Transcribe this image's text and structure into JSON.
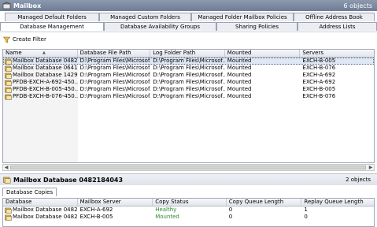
{
  "window": {
    "title": "Mailbox",
    "object_count": "6 objects"
  },
  "tabs_row1": [
    "Managed Default Folders",
    "Managed Custom Folders",
    "Managed Folder Mailbox Policies",
    "Offline Address Book"
  ],
  "tabs_row2": [
    "Database Management",
    "Database Availability Groups",
    "Sharing Policies",
    "Address Lists"
  ],
  "active_tab": "Database Management",
  "toolbar": {
    "create_filter": "Create Filter"
  },
  "grid": {
    "columns": [
      "Name",
      "Database File Path",
      "Log Folder Path",
      "Mounted",
      "Servers"
    ],
    "sort_indicator": "▲",
    "rows": [
      [
        "Mailbox Database 0482...",
        "D:\\Program Files\\Microsof...",
        "D:\\Program Files\\Microsof...",
        "Mounted",
        "EXCH-B-005"
      ],
      [
        "Mailbox Database 0641...",
        "D:\\Program Files\\Microsof...",
        "D:\\Program Files\\Microsof...",
        "Mounted",
        "EXCH-B-076"
      ],
      [
        "Mailbox Database 1429...",
        "D:\\Program Files\\Microsof...",
        "D:\\Program Files\\Microsof...",
        "Mounted",
        "EXCH-A-692"
      ],
      [
        "PFDB-EXCH-A-692-450...",
        "D:\\Program Files\\Microsof...",
        "D:\\Program Files\\Microsof...",
        "Mounted",
        "EXCH-A-692"
      ],
      [
        "PFDB-EXCH-B-005-450...",
        "D:\\Program Files\\Microsof...",
        "D:\\Program Files\\Microsof...",
        "Mounted",
        "EXCH-B-005"
      ],
      [
        "PFDB-EXCH-B-076-450...",
        "D:\\Program Files\\Microsof...",
        "D:\\Program Files\\Microsof...",
        "Mounted",
        "EXCH-B-076"
      ]
    ]
  },
  "detail": {
    "title": "Mailbox Database 0482184043",
    "object_count": "2 objects",
    "tab": "Database Copies",
    "columns": [
      "Database",
      "Mailbox Server",
      "Copy Status",
      "Copy Queue Length",
      "Replay Queue Length"
    ],
    "rows": [
      [
        "Mailbox Database 0482...",
        "EXCH-A-692",
        "Healthy",
        "0",
        "1"
      ],
      [
        "Mailbox Database 0482...",
        "EXCH-B-005",
        "Mounted",
        "0",
        "0"
      ]
    ]
  },
  "colors": {
    "titlebar": "#7a879e",
    "selection": "#dfe7f4",
    "healthy": "#2e8b2e"
  },
  "icons": [
    "mailbox-icon",
    "database-icon",
    "filter-icon"
  ]
}
